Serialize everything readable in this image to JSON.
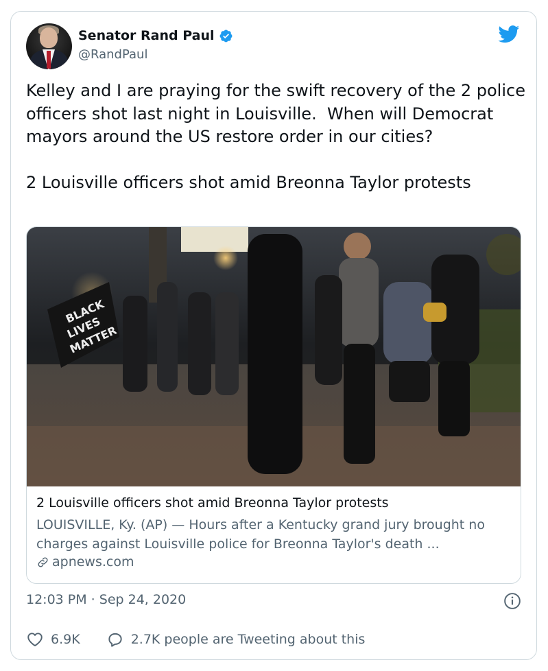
{
  "author": {
    "name": "Senator Rand Paul",
    "handle": "@RandPaul",
    "verified": true
  },
  "tweet": {
    "text": "Kelley and I are praying for the swift recovery of the 2 police officers shot last night in Louisville.  When will Democrat mayors around the US restore order in our cities?\n\n2 Louisville officers shot amid Breonna Taylor protests"
  },
  "link_card": {
    "title": "2 Louisville officers shot amid Breonna Taylor protests",
    "description": "LOUISVILLE, Ky. (AP) — Hours after a Kentucky grand jury brought no charges against Louisville police for Breonna Taylor's death ...",
    "domain": "apnews.com",
    "image": {
      "flag_text_1": "BLACK",
      "flag_text_2": "LIVES",
      "flag_text_3": "MATTER"
    }
  },
  "meta": {
    "timestamp": "12:03 PM · Sep 24, 2020"
  },
  "stats": {
    "likes": "6.9K",
    "tweeting": "2.7K people are Tweeting about this"
  },
  "colors": {
    "twitter_blue": "#1d9bf0",
    "text_primary": "#0f1419",
    "text_secondary": "#536471",
    "border": "#cfd9de"
  },
  "icons": [
    "verified-badge-icon",
    "twitter-bird-icon",
    "link-icon",
    "info-icon",
    "heart-icon",
    "reply-bubble-icon"
  ]
}
